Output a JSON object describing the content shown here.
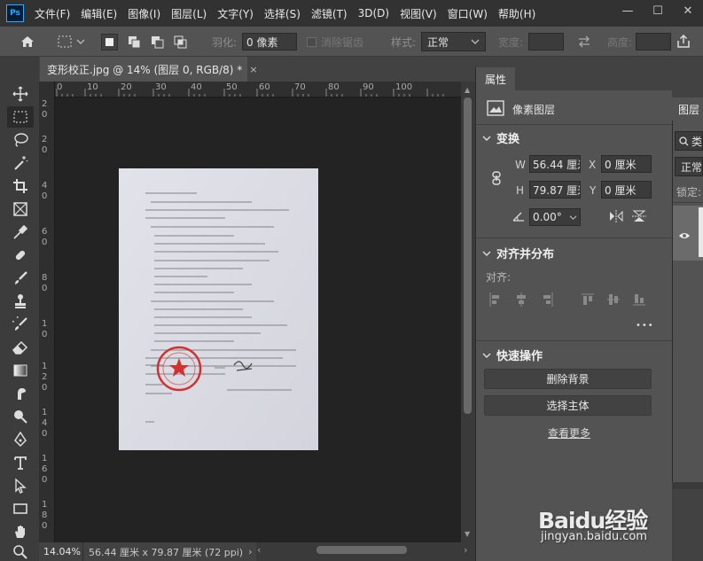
{
  "app": {
    "logo": "Ps"
  },
  "menu": [
    "文件(F)",
    "编辑(E)",
    "图像(I)",
    "图层(L)",
    "文字(Y)",
    "选择(S)",
    "滤镜(T)",
    "3D(D)",
    "视图(V)",
    "窗口(W)",
    "帮助(H)"
  ],
  "window_controls": {
    "minimize": "—",
    "maximize": "☐",
    "close": "✕"
  },
  "options": {
    "feather_label": "羽化:",
    "feather_value": "0 像素",
    "antialias_label": "消除锯齿",
    "style_label": "样式:",
    "style_value": "正常",
    "width_label": "宽度:",
    "height_label": "高度:"
  },
  "document_tab": {
    "title": "变形校正.jpg @ 14% (图层 0, RGB/8) *",
    "close": "×"
  },
  "rulers": {
    "h": [
      "0",
      "10",
      "20",
      "30",
      "40",
      "50",
      "60",
      "70",
      "80",
      "90",
      "100"
    ],
    "v": [
      "2",
      "0",
      "2",
      "0",
      "4",
      "0",
      "6",
      "0",
      "8",
      "0",
      "1",
      "0",
      "1",
      "2",
      "0",
      "1",
      "4",
      "0",
      "1",
      "6",
      "0",
      "1",
      "8",
      "0"
    ]
  },
  "status": {
    "zoom": "14.04%",
    "doc_info": "56.44 厘米 x 79.87 厘米 (72 ppi)",
    "arrow": "›"
  },
  "properties": {
    "tab": "属性",
    "layer_type": "像素图层",
    "transform": {
      "title": "变换",
      "w_label": "W",
      "w_value": "56.44 厘米",
      "h_label": "H",
      "h_value": "79.87 厘米",
      "x_label": "X",
      "x_value": "0 厘米",
      "y_label": "Y",
      "y_value": "0 厘米",
      "angle_value": "0.00°"
    },
    "align": {
      "title": "对齐并分布",
      "align_label": "对齐:",
      "more": "•••"
    },
    "quick": {
      "title": "快速操作",
      "remove_bg": "删除背景",
      "select_subject": "选择主体",
      "see_more": "查看更多"
    }
  },
  "layers": {
    "tab": "图层",
    "kind": "类",
    "blend": "正常",
    "lock": "锁定:"
  },
  "watermark": {
    "brand": "Baidu经验",
    "url": "jingyan.baidu.com"
  }
}
